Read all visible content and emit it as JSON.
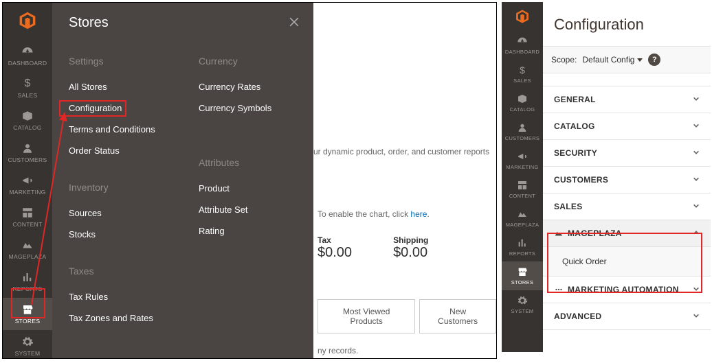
{
  "panelLeft": {
    "sidebar": {
      "items": [
        {
          "label": "DASHBOARD"
        },
        {
          "label": "SALES"
        },
        {
          "label": "CATALOG"
        },
        {
          "label": "CUSTOMERS"
        },
        {
          "label": "MARKETING"
        },
        {
          "label": "CONTENT"
        },
        {
          "label": "MAGEPLAZA"
        },
        {
          "label": "REPORTS"
        },
        {
          "label": "STORES"
        },
        {
          "label": "SYSTEM"
        }
      ]
    },
    "flyout": {
      "title": "Stores",
      "col1": {
        "h1": "Settings",
        "i1": "All Stores",
        "i2": "Configuration",
        "i3": "Terms and Conditions",
        "i4": "Order Status",
        "h2": "Inventory",
        "i5": "Sources",
        "i6": "Stocks",
        "h3": "Taxes",
        "i7": "Tax Rules",
        "i8": "Tax Zones and Rates"
      },
      "col2": {
        "h1": "Currency",
        "i1": "Currency Rates",
        "i2": "Currency Symbols",
        "h2": "Attributes",
        "i3": "Product",
        "i4": "Attribute Set",
        "i5": "Rating"
      }
    },
    "main": {
      "advText": "ur dynamic product, order, and customer reports",
      "chartNote1": "To enable the chart, click ",
      "chartNoteLink": "here",
      "chartNote2": ".",
      "stats": {
        "taxLabel": "Tax",
        "taxValue": "$0.00",
        "shipLabel": "Shipping",
        "shipValue": "$0.00"
      },
      "tab1": "Most Viewed Products",
      "tab2": "New Customers",
      "noRecords": "ny records."
    }
  },
  "panelRight": {
    "sidebar": {
      "items": [
        {
          "label": "DASHBOARD"
        },
        {
          "label": "SALES"
        },
        {
          "label": "CATALOG"
        },
        {
          "label": "CUSTOMERS"
        },
        {
          "label": "MARKETING"
        },
        {
          "label": "CONTENT"
        },
        {
          "label": "MAGEPLAZA"
        },
        {
          "label": "REPORTS"
        },
        {
          "label": "STORES"
        },
        {
          "label": "SYSTEM"
        }
      ]
    },
    "cfg": {
      "title": "Configuration",
      "scopeLabel": "Scope:",
      "scopeValue": "Default Config",
      "tabs": {
        "general": "GENERAL",
        "catalog": "CATALOG",
        "security": "SECURITY",
        "customers": "CUSTOMERS",
        "sales": "SALES",
        "mageplaza": "MAGEPLAZA",
        "mageplazaSub": "Quick Order",
        "marketing": "MARKETING AUTOMATION",
        "advanced": "ADVANCED"
      }
    }
  }
}
